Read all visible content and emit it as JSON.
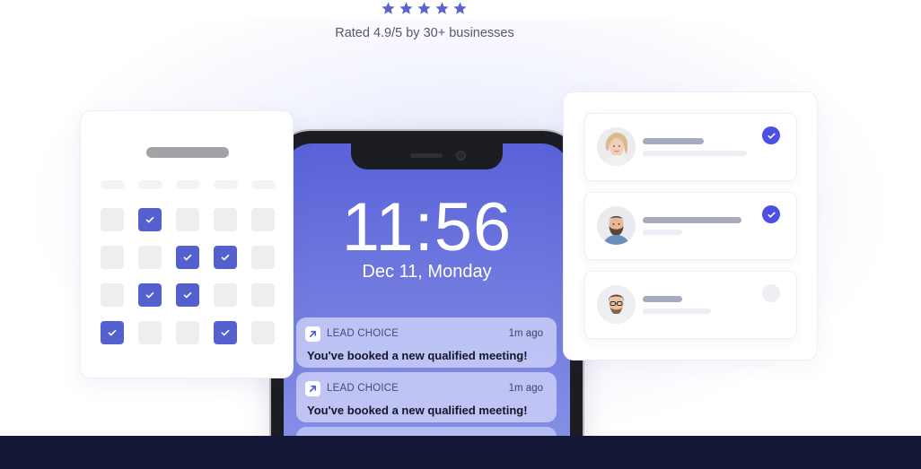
{
  "rating": {
    "stars": 5,
    "star_color": "#5b63cf",
    "text": "Rated 4.9/5 by 30+ businesses"
  },
  "calendar": {
    "rows": [
      [
        false,
        true,
        false,
        false,
        false
      ],
      [
        false,
        false,
        true,
        true,
        false
      ],
      [
        false,
        true,
        true,
        false,
        false
      ],
      [
        true,
        false,
        false,
        true,
        false
      ]
    ],
    "accent": "#5560cf"
  },
  "phone": {
    "time": "11:56",
    "date": "Dec 11, Monday",
    "notifications": [
      {
        "app": "LEAD CHOICE",
        "time": "1m ago",
        "message": "You've booked a new qualified meeting!"
      },
      {
        "app": "LEAD CHOICE",
        "time": "1m ago",
        "message": "You've booked a new qualified meeting!"
      }
    ]
  },
  "contacts": [
    {
      "avatar": "woman-avatar",
      "checked": true
    },
    {
      "avatar": "bearded-man-avatar",
      "checked": true
    },
    {
      "avatar": "man-glasses-avatar",
      "checked": false
    }
  ],
  "colors": {
    "check_blue": "#4c4ee6",
    "footer": "#151736"
  }
}
